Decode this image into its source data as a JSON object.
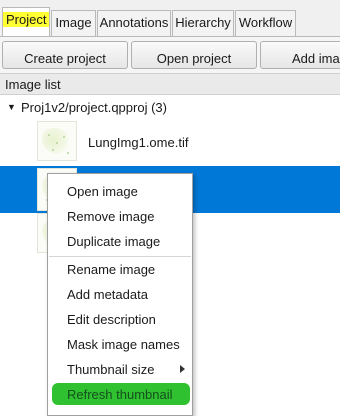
{
  "tabs": [
    {
      "label": "Project",
      "active": true,
      "highlight": "#ffff33"
    },
    {
      "label": "Image",
      "active": false
    },
    {
      "label": "Annotations",
      "active": false
    },
    {
      "label": "Hierarchy",
      "active": false
    },
    {
      "label": "Workflow",
      "active": false
    }
  ],
  "toolbar": {
    "create_project": "Create project",
    "open_project": "Open project",
    "add_images": "Add imag"
  },
  "image_list": {
    "header": "Image list",
    "project_label": "Proj1v2/project.qpproj (3)",
    "items": [
      {
        "name": "LungImg1.ome.tif",
        "selected": false
      },
      {
        "name": "",
        "selected": true
      },
      {
        "name": "",
        "selected": false
      }
    ]
  },
  "context_menu": {
    "items": [
      "Open image",
      "Remove image",
      "Duplicate image",
      "Rename image",
      "Add metadata",
      "Edit description",
      "Mask image names",
      "Thumbnail size",
      "Refresh thumbnail"
    ],
    "has_submenu": "Thumbnail size",
    "highlighted": "Refresh thumbnail"
  },
  "colors": {
    "selection": "#0078d7",
    "tab_highlight": "#ffff33",
    "menu_highlight": "#2fc12f"
  },
  "icons": [
    "tree-expanded-arrow-icon",
    "submenu-arrow-icon",
    "image-thumbnail"
  ]
}
